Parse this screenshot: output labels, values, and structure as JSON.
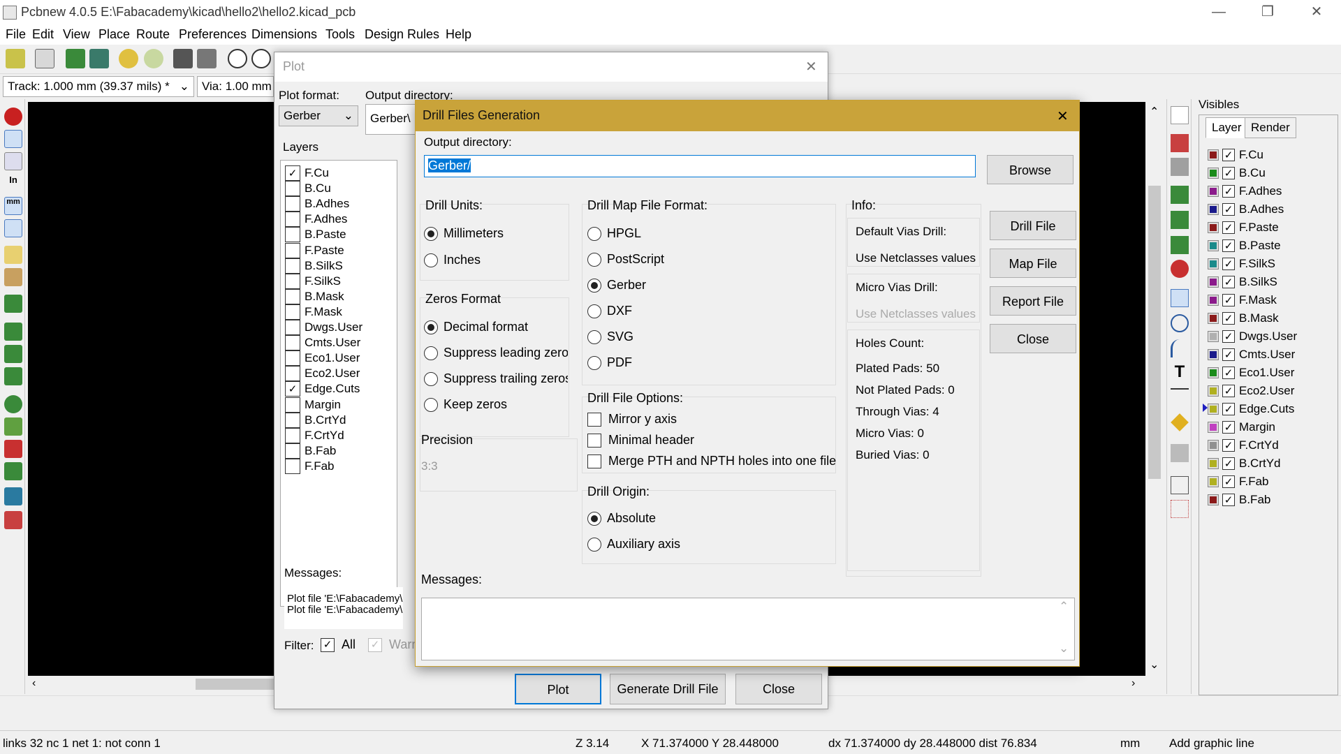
{
  "window": {
    "title": "Pcbnew 4.0.5 E:\\Fabacademy\\kicad\\hello2\\hello2.kicad_pcb",
    "min": "—",
    "restore": "❐",
    "close": "✕"
  },
  "menu": [
    "File",
    "Edit",
    "View",
    "Place",
    "Route",
    "Preferences",
    "Dimensions",
    "Tools",
    "Design Rules",
    "Help"
  ],
  "optbar": {
    "track": "Track: 1.000 mm (39.37 mils) *",
    "via": "Via: 1.00 mm"
  },
  "visibles": {
    "header": "Visibles",
    "tabs": [
      "Layer",
      "Render"
    ],
    "layers": [
      {
        "name": "F.Cu",
        "color": "#8b1a1a"
      },
      {
        "name": "B.Cu",
        "color": "#1a8b1a"
      },
      {
        "name": "F.Adhes",
        "color": "#8b1a8b"
      },
      {
        "name": "B.Adhes",
        "color": "#1a1a8b"
      },
      {
        "name": "F.Paste",
        "color": "#8b1a1a"
      },
      {
        "name": "B.Paste",
        "color": "#1a8b8b"
      },
      {
        "name": "F.SilkS",
        "color": "#1a8b8b"
      },
      {
        "name": "B.SilkS",
        "color": "#8b1a8b"
      },
      {
        "name": "F.Mask",
        "color": "#8b1a8b"
      },
      {
        "name": "B.Mask",
        "color": "#8b1a1a"
      },
      {
        "name": "Dwgs.User",
        "color": "#b0b0b0"
      },
      {
        "name": "Cmts.User",
        "color": "#1a1a8b"
      },
      {
        "name": "Eco1.User",
        "color": "#1a8b1a"
      },
      {
        "name": "Eco2.User",
        "color": "#b0b020"
      },
      {
        "name": "Edge.Cuts",
        "color": "#b0b020"
      },
      {
        "name": "Margin",
        "color": "#c040c0"
      },
      {
        "name": "F.CrtYd",
        "color": "#909090"
      },
      {
        "name": "B.CrtYd",
        "color": "#b0b020"
      },
      {
        "name": "F.Fab",
        "color": "#b0b020"
      },
      {
        "name": "B.Fab",
        "color": "#8b1a1a"
      }
    ]
  },
  "plot": {
    "title": "Plot",
    "plot_format_label": "Plot format:",
    "plot_format_value": "Gerber",
    "output_dir_label": "Output directory:",
    "output_dir_value": "Gerber\\",
    "layers_label": "Layers",
    "layers": [
      {
        "name": "F.Cu",
        "checked": true
      },
      {
        "name": "B.Cu",
        "checked": false
      },
      {
        "name": "B.Adhes",
        "checked": false
      },
      {
        "name": "F.Adhes",
        "checked": false
      },
      {
        "name": "B.Paste",
        "checked": false
      },
      {
        "name": "F.Paste",
        "checked": false
      },
      {
        "name": "B.SilkS",
        "checked": false
      },
      {
        "name": "F.SilkS",
        "checked": false
      },
      {
        "name": "B.Mask",
        "checked": false
      },
      {
        "name": "F.Mask",
        "checked": false
      },
      {
        "name": "Dwgs.User",
        "checked": false
      },
      {
        "name": "Cmts.User",
        "checked": false
      },
      {
        "name": "Eco1.User",
        "checked": false
      },
      {
        "name": "Eco2.User",
        "checked": false
      },
      {
        "name": "Edge.Cuts",
        "checked": true
      },
      {
        "name": "Margin",
        "checked": false
      },
      {
        "name": "B.CrtYd",
        "checked": false
      },
      {
        "name": "F.CrtYd",
        "checked": false
      },
      {
        "name": "B.Fab",
        "checked": false
      },
      {
        "name": "F.Fab",
        "checked": false
      }
    ],
    "messages_label": "Messages:",
    "messages": [
      "Plot file 'E:\\Fabacademy\\",
      "Plot file 'E:\\Fabacademy\\"
    ],
    "filter_label": "Filter:",
    "filter_all": "All",
    "filter_warn": "Warn",
    "plot_button": "Plot",
    "generate_drill_button": "Generate Drill File",
    "close_button": "Close"
  },
  "drill": {
    "title": "Drill Files Generation",
    "close_glyph": "✕",
    "output_dir_label": "Output directory:",
    "output_dir_value": "Gerber/",
    "browse": "Browse",
    "drill_units_label": "Drill Units:",
    "units": [
      {
        "label": "Millimeters",
        "on": true
      },
      {
        "label": "Inches",
        "on": false
      }
    ],
    "zeros_label": "Zeros Format",
    "zeros": [
      {
        "label": "Decimal format",
        "on": true
      },
      {
        "label": "Suppress leading zeros",
        "on": false
      },
      {
        "label": "Suppress trailing zeros",
        "on": false
      },
      {
        "label": "Keep zeros",
        "on": false
      }
    ],
    "precision_label": "Precision",
    "precision_value": "3:3",
    "map_format_label": "Drill Map File Format:",
    "map_formats": [
      {
        "label": "HPGL",
        "on": false
      },
      {
        "label": "PostScript",
        "on": false
      },
      {
        "label": "Gerber",
        "on": true
      },
      {
        "label": "DXF",
        "on": false
      },
      {
        "label": "SVG",
        "on": false
      },
      {
        "label": "PDF",
        "on": false
      }
    ],
    "file_options_label": "Drill File Options:",
    "file_options": [
      {
        "label": "Mirror y axis",
        "checked": false
      },
      {
        "label": "Minimal header",
        "checked": false
      },
      {
        "label": "Merge PTH and NPTH holes into one file",
        "checked": false
      }
    ],
    "origin_label": "Drill Origin:",
    "origins": [
      {
        "label": "Absolute",
        "on": true
      },
      {
        "label": "Auxiliary axis",
        "on": false
      }
    ],
    "info_label": "Info:",
    "default_vias_label": "Default Vias Drill:",
    "default_vias_value": "Use Netclasses values",
    "micro_vias_label": "Micro Vias Drill:",
    "micro_vias_value": "Use Netclasses values",
    "holes_label": "Holes Count:",
    "holes": [
      "Plated Pads: 50",
      "Not Plated Pads: 0",
      "Through Vias: 4",
      "Micro Vias: 0",
      "Buried Vias: 0"
    ],
    "buttons": [
      "Drill File",
      "Map File",
      "Report File",
      "Close"
    ],
    "messages_label": "Messages:"
  },
  "status": {
    "links": "links 32 nc 1  net 1: not conn 1",
    "zoom": "Z 3.14",
    "xy": "X 71.374000  Y 28.448000",
    "dxy": "dx 71.374000  dy 28.448000  dist 76.834",
    "units": "mm",
    "mode": "Add graphic line"
  }
}
